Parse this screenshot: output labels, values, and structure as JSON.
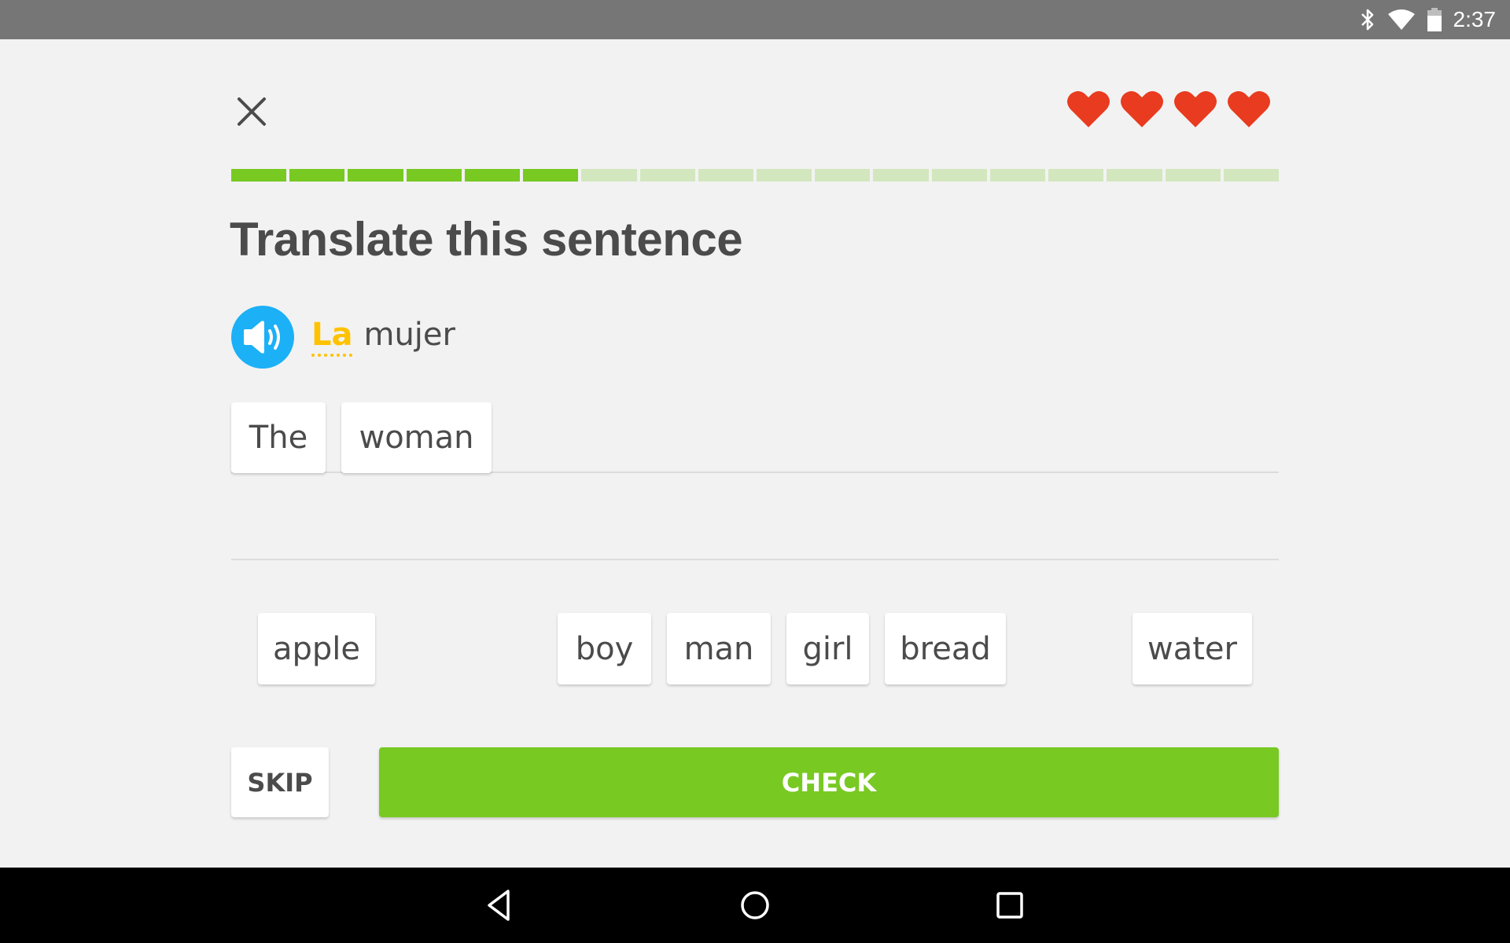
{
  "status_bar": {
    "icons": [
      "bluetooth-icon",
      "wifi-icon",
      "battery-icon"
    ],
    "time": "2:37"
  },
  "header": {
    "close_icon": "close-icon",
    "hearts": {
      "count": 4,
      "color": "#e83b1f"
    },
    "progress": {
      "total_segments": 18,
      "completed_segments": 6,
      "filled_color": "#78c922",
      "empty_color": "#d3e7bf"
    }
  },
  "challenge": {
    "title": "Translate this sentence",
    "speaker_icon": "speaker-icon",
    "prompt_words": [
      {
        "text": "La",
        "hint": true
      },
      {
        "text": "mujer",
        "hint": false
      }
    ]
  },
  "answer": {
    "selected_words": [
      "The",
      "woman"
    ]
  },
  "word_bank": {
    "words": [
      "apple",
      "boy",
      "man",
      "girl",
      "bread",
      "water"
    ]
  },
  "footer": {
    "skip_label": "SKIP",
    "check_label": "CHECK",
    "check_color": "#78c922"
  },
  "nav_bar": {
    "buttons": [
      "back-icon",
      "home-icon",
      "recents-icon"
    ]
  }
}
